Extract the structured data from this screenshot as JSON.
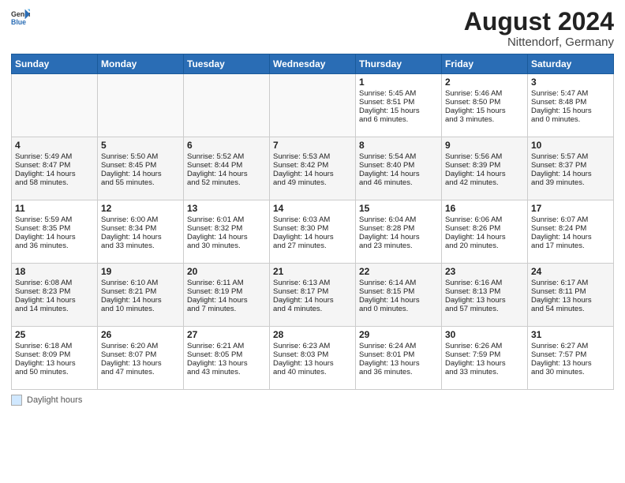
{
  "header": {
    "logo_general": "General",
    "logo_blue": "Blue",
    "month_year": "August 2024",
    "location": "Nittendorf, Germany"
  },
  "days_of_week": [
    "Sunday",
    "Monday",
    "Tuesday",
    "Wednesday",
    "Thursday",
    "Friday",
    "Saturday"
  ],
  "footer": {
    "label": "Daylight hours"
  },
  "weeks": [
    [
      {
        "day": "",
        "info": ""
      },
      {
        "day": "",
        "info": ""
      },
      {
        "day": "",
        "info": ""
      },
      {
        "day": "",
        "info": ""
      },
      {
        "day": "1",
        "info": "Sunrise: 5:45 AM\nSunset: 8:51 PM\nDaylight: 15 hours\nand 6 minutes."
      },
      {
        "day": "2",
        "info": "Sunrise: 5:46 AM\nSunset: 8:50 PM\nDaylight: 15 hours\nand 3 minutes."
      },
      {
        "day": "3",
        "info": "Sunrise: 5:47 AM\nSunset: 8:48 PM\nDaylight: 15 hours\nand 0 minutes."
      }
    ],
    [
      {
        "day": "4",
        "info": "Sunrise: 5:49 AM\nSunset: 8:47 PM\nDaylight: 14 hours\nand 58 minutes."
      },
      {
        "day": "5",
        "info": "Sunrise: 5:50 AM\nSunset: 8:45 PM\nDaylight: 14 hours\nand 55 minutes."
      },
      {
        "day": "6",
        "info": "Sunrise: 5:52 AM\nSunset: 8:44 PM\nDaylight: 14 hours\nand 52 minutes."
      },
      {
        "day": "7",
        "info": "Sunrise: 5:53 AM\nSunset: 8:42 PM\nDaylight: 14 hours\nand 49 minutes."
      },
      {
        "day": "8",
        "info": "Sunrise: 5:54 AM\nSunset: 8:40 PM\nDaylight: 14 hours\nand 46 minutes."
      },
      {
        "day": "9",
        "info": "Sunrise: 5:56 AM\nSunset: 8:39 PM\nDaylight: 14 hours\nand 42 minutes."
      },
      {
        "day": "10",
        "info": "Sunrise: 5:57 AM\nSunset: 8:37 PM\nDaylight: 14 hours\nand 39 minutes."
      }
    ],
    [
      {
        "day": "11",
        "info": "Sunrise: 5:59 AM\nSunset: 8:35 PM\nDaylight: 14 hours\nand 36 minutes."
      },
      {
        "day": "12",
        "info": "Sunrise: 6:00 AM\nSunset: 8:34 PM\nDaylight: 14 hours\nand 33 minutes."
      },
      {
        "day": "13",
        "info": "Sunrise: 6:01 AM\nSunset: 8:32 PM\nDaylight: 14 hours\nand 30 minutes."
      },
      {
        "day": "14",
        "info": "Sunrise: 6:03 AM\nSunset: 8:30 PM\nDaylight: 14 hours\nand 27 minutes."
      },
      {
        "day": "15",
        "info": "Sunrise: 6:04 AM\nSunset: 8:28 PM\nDaylight: 14 hours\nand 23 minutes."
      },
      {
        "day": "16",
        "info": "Sunrise: 6:06 AM\nSunset: 8:26 PM\nDaylight: 14 hours\nand 20 minutes."
      },
      {
        "day": "17",
        "info": "Sunrise: 6:07 AM\nSunset: 8:24 PM\nDaylight: 14 hours\nand 17 minutes."
      }
    ],
    [
      {
        "day": "18",
        "info": "Sunrise: 6:08 AM\nSunset: 8:23 PM\nDaylight: 14 hours\nand 14 minutes."
      },
      {
        "day": "19",
        "info": "Sunrise: 6:10 AM\nSunset: 8:21 PM\nDaylight: 14 hours\nand 10 minutes."
      },
      {
        "day": "20",
        "info": "Sunrise: 6:11 AM\nSunset: 8:19 PM\nDaylight: 14 hours\nand 7 minutes."
      },
      {
        "day": "21",
        "info": "Sunrise: 6:13 AM\nSunset: 8:17 PM\nDaylight: 14 hours\nand 4 minutes."
      },
      {
        "day": "22",
        "info": "Sunrise: 6:14 AM\nSunset: 8:15 PM\nDaylight: 14 hours\nand 0 minutes."
      },
      {
        "day": "23",
        "info": "Sunrise: 6:16 AM\nSunset: 8:13 PM\nDaylight: 13 hours\nand 57 minutes."
      },
      {
        "day": "24",
        "info": "Sunrise: 6:17 AM\nSunset: 8:11 PM\nDaylight: 13 hours\nand 54 minutes."
      }
    ],
    [
      {
        "day": "25",
        "info": "Sunrise: 6:18 AM\nSunset: 8:09 PM\nDaylight: 13 hours\nand 50 minutes."
      },
      {
        "day": "26",
        "info": "Sunrise: 6:20 AM\nSunset: 8:07 PM\nDaylight: 13 hours\nand 47 minutes."
      },
      {
        "day": "27",
        "info": "Sunrise: 6:21 AM\nSunset: 8:05 PM\nDaylight: 13 hours\nand 43 minutes."
      },
      {
        "day": "28",
        "info": "Sunrise: 6:23 AM\nSunset: 8:03 PM\nDaylight: 13 hours\nand 40 minutes."
      },
      {
        "day": "29",
        "info": "Sunrise: 6:24 AM\nSunset: 8:01 PM\nDaylight: 13 hours\nand 36 minutes."
      },
      {
        "day": "30",
        "info": "Sunrise: 6:26 AM\nSunset: 7:59 PM\nDaylight: 13 hours\nand 33 minutes."
      },
      {
        "day": "31",
        "info": "Sunrise: 6:27 AM\nSunset: 7:57 PM\nDaylight: 13 hours\nand 30 minutes."
      }
    ]
  ]
}
